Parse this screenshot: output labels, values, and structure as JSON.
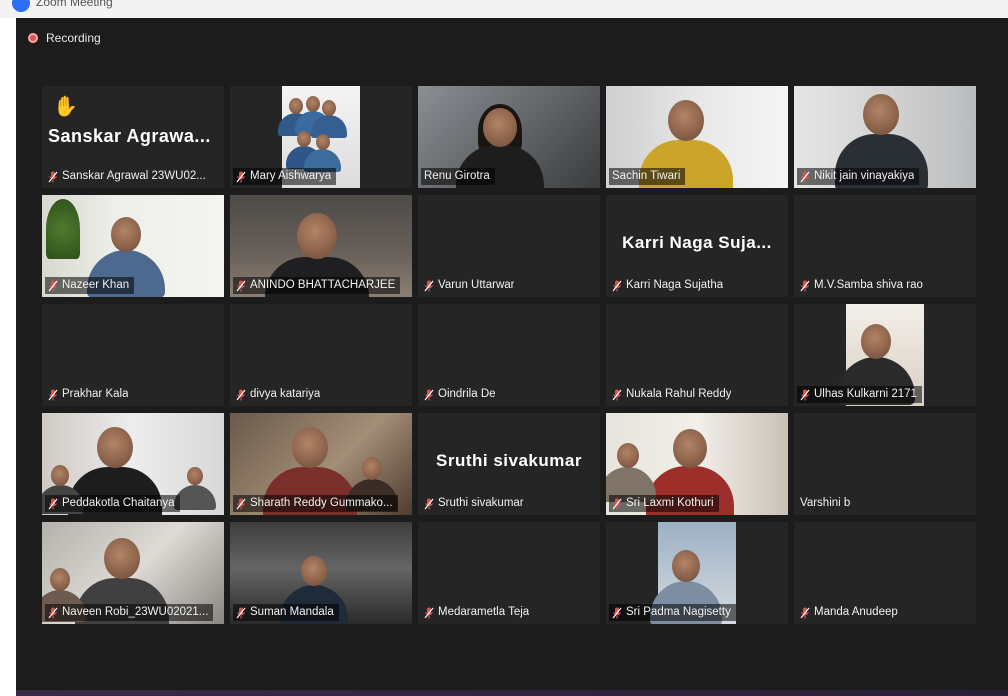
{
  "app": {
    "title": "Zoom Meeting"
  },
  "recording": {
    "label": "Recording"
  },
  "colors": {
    "active_speaker": "#c7e36a",
    "mic_muted": "#d9534f",
    "tile_bg": "#252525",
    "window_bg": "#1c1c1c"
  },
  "participants": [
    {
      "name": "Sanskar Agrawal 23WU02...",
      "display_name": "Sanskar  Agrawa...",
      "video": false,
      "muted": true,
      "raised_hand": true
    },
    {
      "name": "Mary Aishwarya",
      "video": true,
      "muted": true
    },
    {
      "name": "Renu Girotra",
      "video": true,
      "muted": false,
      "active": true
    },
    {
      "name": "Sachin Tiwari",
      "video": true,
      "muted": false
    },
    {
      "name": "Nikit jain vinayakiya",
      "video": true,
      "muted": true
    },
    {
      "name": "Nazeer Khan",
      "video": true,
      "muted": true
    },
    {
      "name": "ANINDO BHATTACHARJEE",
      "video": true,
      "muted": true
    },
    {
      "name": "Varun Uttarwar",
      "video": false,
      "muted": true
    },
    {
      "name": "Karri Naga Sujatha",
      "display_name": "Karri  Naga  Suja...",
      "video": false,
      "muted": true
    },
    {
      "name": "M.V.Samba shiva rao",
      "video": false,
      "muted": true
    },
    {
      "name": "Prakhar Kala",
      "video": false,
      "muted": true
    },
    {
      "name": "divya katariya",
      "video": false,
      "muted": true
    },
    {
      "name": "Oindrila De",
      "video": false,
      "muted": true
    },
    {
      "name": "Nukala Rahul Reddy",
      "video": false,
      "muted": true
    },
    {
      "name": "Ulhas Kulkarni 2171",
      "video": true,
      "muted": true
    },
    {
      "name": "Peddakotla Chaitanya",
      "video": true,
      "muted": true
    },
    {
      "name": "Sharath Reddy Gummako...",
      "video": true,
      "muted": true
    },
    {
      "name": "Sruthi sivakumar",
      "display_name": "Sruthi sivakumar",
      "video": false,
      "muted": true
    },
    {
      "name": "Sri Laxmi Kothuri",
      "video": true,
      "muted": true
    },
    {
      "name": "Varshini b",
      "video": false,
      "muted": false
    },
    {
      "name": "Naveen Robi_23WU02021...",
      "video": true,
      "muted": true
    },
    {
      "name": "Suman Mandala",
      "video": true,
      "muted": true
    },
    {
      "name": "Medarametla Teja",
      "video": false,
      "muted": true
    },
    {
      "name": "Sri Padma Nagisetty",
      "video": true,
      "muted": true
    },
    {
      "name": "Manda Anudeep",
      "video": false,
      "muted": true
    }
  ]
}
